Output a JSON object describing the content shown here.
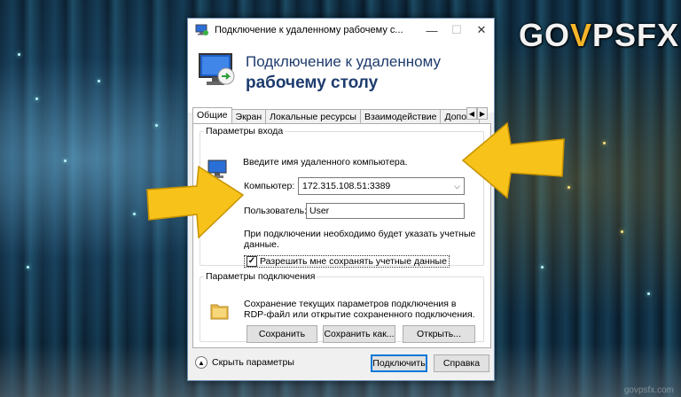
{
  "logo": {
    "pre": "GO",
    "mark": "V",
    "post": "PSFX"
  },
  "watermark": "govpsfx.com",
  "window": {
    "title": "Подключение к удаленному рабочему с...",
    "controls": {
      "minimize": "—",
      "maximize": "☐",
      "close": "✕"
    }
  },
  "banner": {
    "line1": "Подключение к удаленному",
    "line2": "рабочему столу"
  },
  "tabs": [
    "Общие",
    "Экран",
    "Локальные ресурсы",
    "Взаимодействие",
    "Дополни"
  ],
  "tab_scroll": {
    "left": "◀",
    "right": "▶"
  },
  "logon": {
    "group_title": "Параметры входа",
    "instruction": "Введите имя удаленного компьютера.",
    "computer_label": "Компьютер:",
    "computer_value": "172.315.108.51:3389",
    "user_label": "Пользователь:",
    "user_value": "User",
    "note_line1": "При подключении необходимо будет указать учетные",
    "note_line2": "данные.",
    "save_checkbox_label": "Разрешить мне сохранять учетные данные",
    "save_checkbox_checked": true,
    "check_mark": "✓"
  },
  "connection": {
    "group_title": "Параметры подключения",
    "desc_line1": "Сохранение текущих параметров подключения в",
    "desc_line2": "RDP-файл или открытие сохраненного подключения.",
    "save_button": "Сохранить",
    "save_as_button": "Сохранить как...",
    "open_button": "Открыть..."
  },
  "footer": {
    "toggle_icon": "▲",
    "hide_options": "Скрыть параметры",
    "connect_button": "Подключить",
    "help_button": "Справка"
  },
  "colors": {
    "accent": "#0078d7",
    "banner_text": "#1e3c6e",
    "arrow": "#f7c21a",
    "logo_mark": "#f6b52a"
  }
}
